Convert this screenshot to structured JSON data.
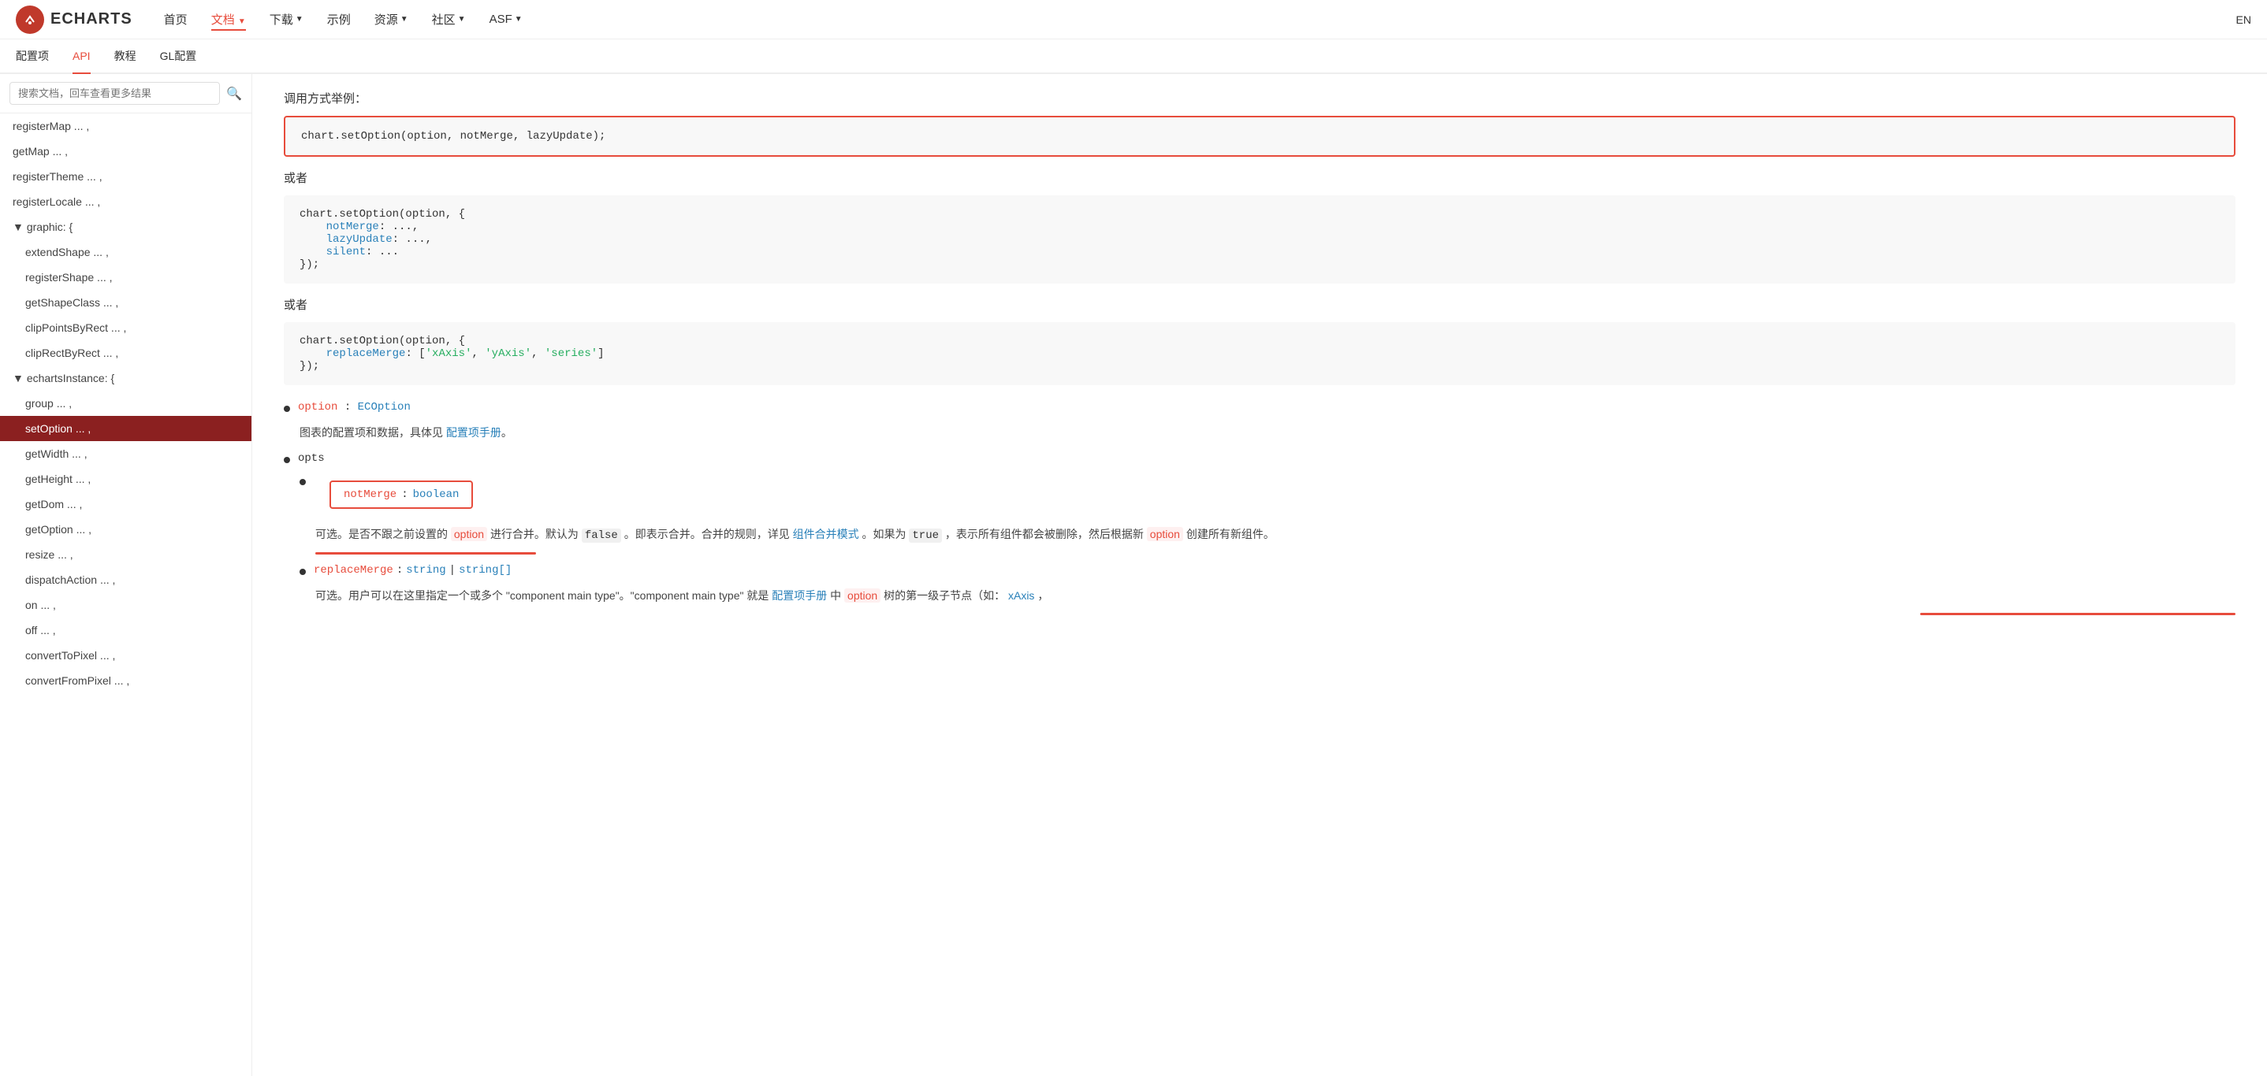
{
  "nav": {
    "logo_text": "ECHARTS",
    "items": [
      {
        "label": "首页",
        "active": false
      },
      {
        "label": "文档",
        "active": true,
        "dropdown": true
      },
      {
        "label": "下载",
        "active": false,
        "dropdown": true
      },
      {
        "label": "示例",
        "active": false
      },
      {
        "label": "资源",
        "active": false,
        "dropdown": true
      },
      {
        "label": "社区",
        "active": false,
        "dropdown": true
      },
      {
        "label": "ASF",
        "active": false,
        "dropdown": true
      }
    ],
    "lang": "EN"
  },
  "sub_nav": {
    "items": [
      {
        "label": "配置项",
        "active": false
      },
      {
        "label": "API",
        "active": true
      },
      {
        "label": "教程",
        "active": false
      },
      {
        "label": "GL配置",
        "active": false
      }
    ]
  },
  "sidebar": {
    "search_placeholder": "搜索文档，回车查看更多结果",
    "items": [
      {
        "label": "registerMap ... ,",
        "indent": 0
      },
      {
        "label": "getMap ... ,",
        "indent": 0
      },
      {
        "label": "registerTheme ... ,",
        "indent": 0
      },
      {
        "label": "registerLocale ... ,",
        "indent": 0
      },
      {
        "label": "graphic: {",
        "indent": 0,
        "section": true
      },
      {
        "label": "extendShape ... ,",
        "indent": 1
      },
      {
        "label": "registerShape ... ,",
        "indent": 1
      },
      {
        "label": "getShapeClass ... ,",
        "indent": 1
      },
      {
        "label": "clipPointsByRect ... ,",
        "indent": 1
      },
      {
        "label": "clipRectByRect ... ,",
        "indent": 1
      },
      {
        "label": "echartsInstance: {",
        "indent": 0,
        "section": true
      },
      {
        "label": "group ... ,",
        "indent": 1
      },
      {
        "label": "setOption ... ,",
        "indent": 1,
        "active": true
      },
      {
        "label": "getWidth ... ,",
        "indent": 1
      },
      {
        "label": "getHeight ... ,",
        "indent": 1
      },
      {
        "label": "getDom ... ,",
        "indent": 1
      },
      {
        "label": "getOption ... ,",
        "indent": 1
      },
      {
        "label": "resize ... ,",
        "indent": 1
      },
      {
        "label": "dispatchAction ... ,",
        "indent": 1
      },
      {
        "label": "on ... ,",
        "indent": 1
      },
      {
        "label": "off ... ,",
        "indent": 1
      },
      {
        "label": "convertToPixel ... ,",
        "indent": 1
      },
      {
        "label": "convertFromPixel ... ,",
        "indent": 1
      }
    ]
  },
  "content": {
    "call_example_label": "调用方式举例：",
    "code1": "chart.setOption(option, notMerge, lazyUpdate);",
    "or1": "或者",
    "code2_line1": "chart.setOption(option, {",
    "code2_line2": "    notMerge: ...,",
    "code2_line3": "    lazyUpdate: ...,",
    "code2_line4": "    silent: ...",
    "code2_line5": "});",
    "or2": "或者",
    "code3_line1": "chart.setOption(option, {",
    "code3_line2": "    replaceMerge: ['xAxis', 'yAxis', 'series']",
    "code3_line3": "});",
    "param_option_label": "option",
    "param_option_type": ": ECOption",
    "param_option_desc": "图表的配置项和数据，具体见",
    "param_option_link": "配置项手册",
    "param_option_end": "。",
    "opts_label": "opts",
    "notmerge_label": "notMerge",
    "notmerge_colon": ":",
    "notmerge_type": "boolean",
    "notmerge_desc_before": "可选。是否不跟之前设置的",
    "notmerge_option_word": "option",
    "notmerge_desc_mid": "进行合并。默认为",
    "notmerge_false_word": "false",
    "notmerge_desc_mid2": "。即表示合并。合并的规则，详见",
    "notmerge_link": "组件合并模式",
    "notmerge_desc_end": "。如果为",
    "notmerge_true_word": "true",
    "notmerge_desc_end2": "，表示所有组件都会被删除，然后根据新",
    "notmerge_option_word2": "option",
    "notmerge_desc_final": "创建所有新组件。",
    "replacemerge_label": "replaceMerge",
    "replacemerge_colon": ":",
    "replacemerge_type1": "string",
    "replacemerge_sep": "|",
    "replacemerge_type2": "string[]",
    "replacemerge_desc": "可选。用户可以在这里指定一个或多个 \"component main type\"。\"component main type\" 就是",
    "replacemerge_link": "配置项手册",
    "replacemerge_desc2": "中",
    "replacemerge_option_word": "option",
    "replacemerge_desc3": "树的第一级子节点（如：",
    "replacemerge_xaxis": "xAxis",
    "replacemerge_desc4": "，"
  }
}
